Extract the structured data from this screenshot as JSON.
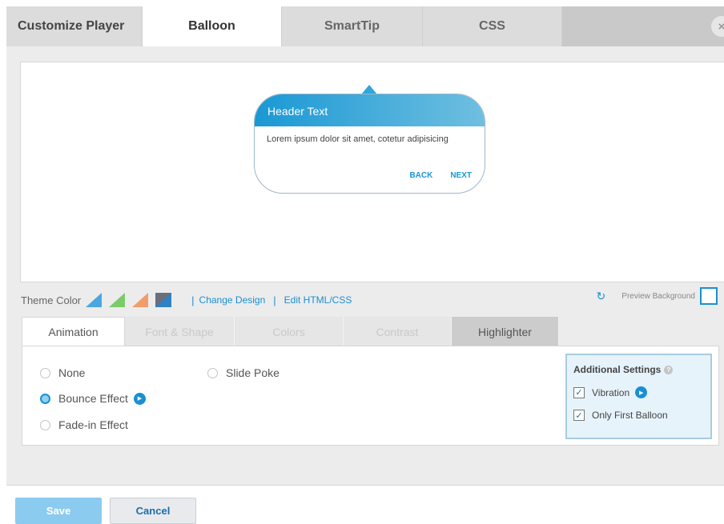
{
  "tabs": [
    "Customize Player",
    "Balloon",
    "SmartTip",
    "CSS"
  ],
  "close_icon": "×",
  "preview": {
    "balloon_header": "Header Text",
    "balloon_body": "Lorem ipsum dolor sit amet, cotetur adipisicing",
    "back_label": "BACK",
    "next_label": "NEXT"
  },
  "theme": {
    "label": "Theme Color",
    "swatches": [
      "#4aa6e0",
      "#7bcb6b",
      "#f39c6b",
      "#2d82c4"
    ],
    "change_design": "Change Design",
    "edit_html_css": "Edit HTML/CSS",
    "preview_background": "Preview Background"
  },
  "sub_tabs": [
    "Animation",
    "Font & Shape",
    "Colors",
    "Contrast",
    "Highlighter"
  ],
  "animation": {
    "options": [
      {
        "label": "None",
        "selected": false
      },
      {
        "label": "Bounce Effect",
        "selected": true
      },
      {
        "label": "Fade-in Effect",
        "selected": false
      },
      {
        "label": "Slide Poke",
        "selected": false
      }
    ]
  },
  "settings": {
    "title": "Additional Settings",
    "vibration": "Vibration",
    "only_first": "Only First Balloon"
  },
  "buttons": {
    "save": "Save",
    "cancel": "Cancel"
  },
  "accent": "#1a8fd1"
}
